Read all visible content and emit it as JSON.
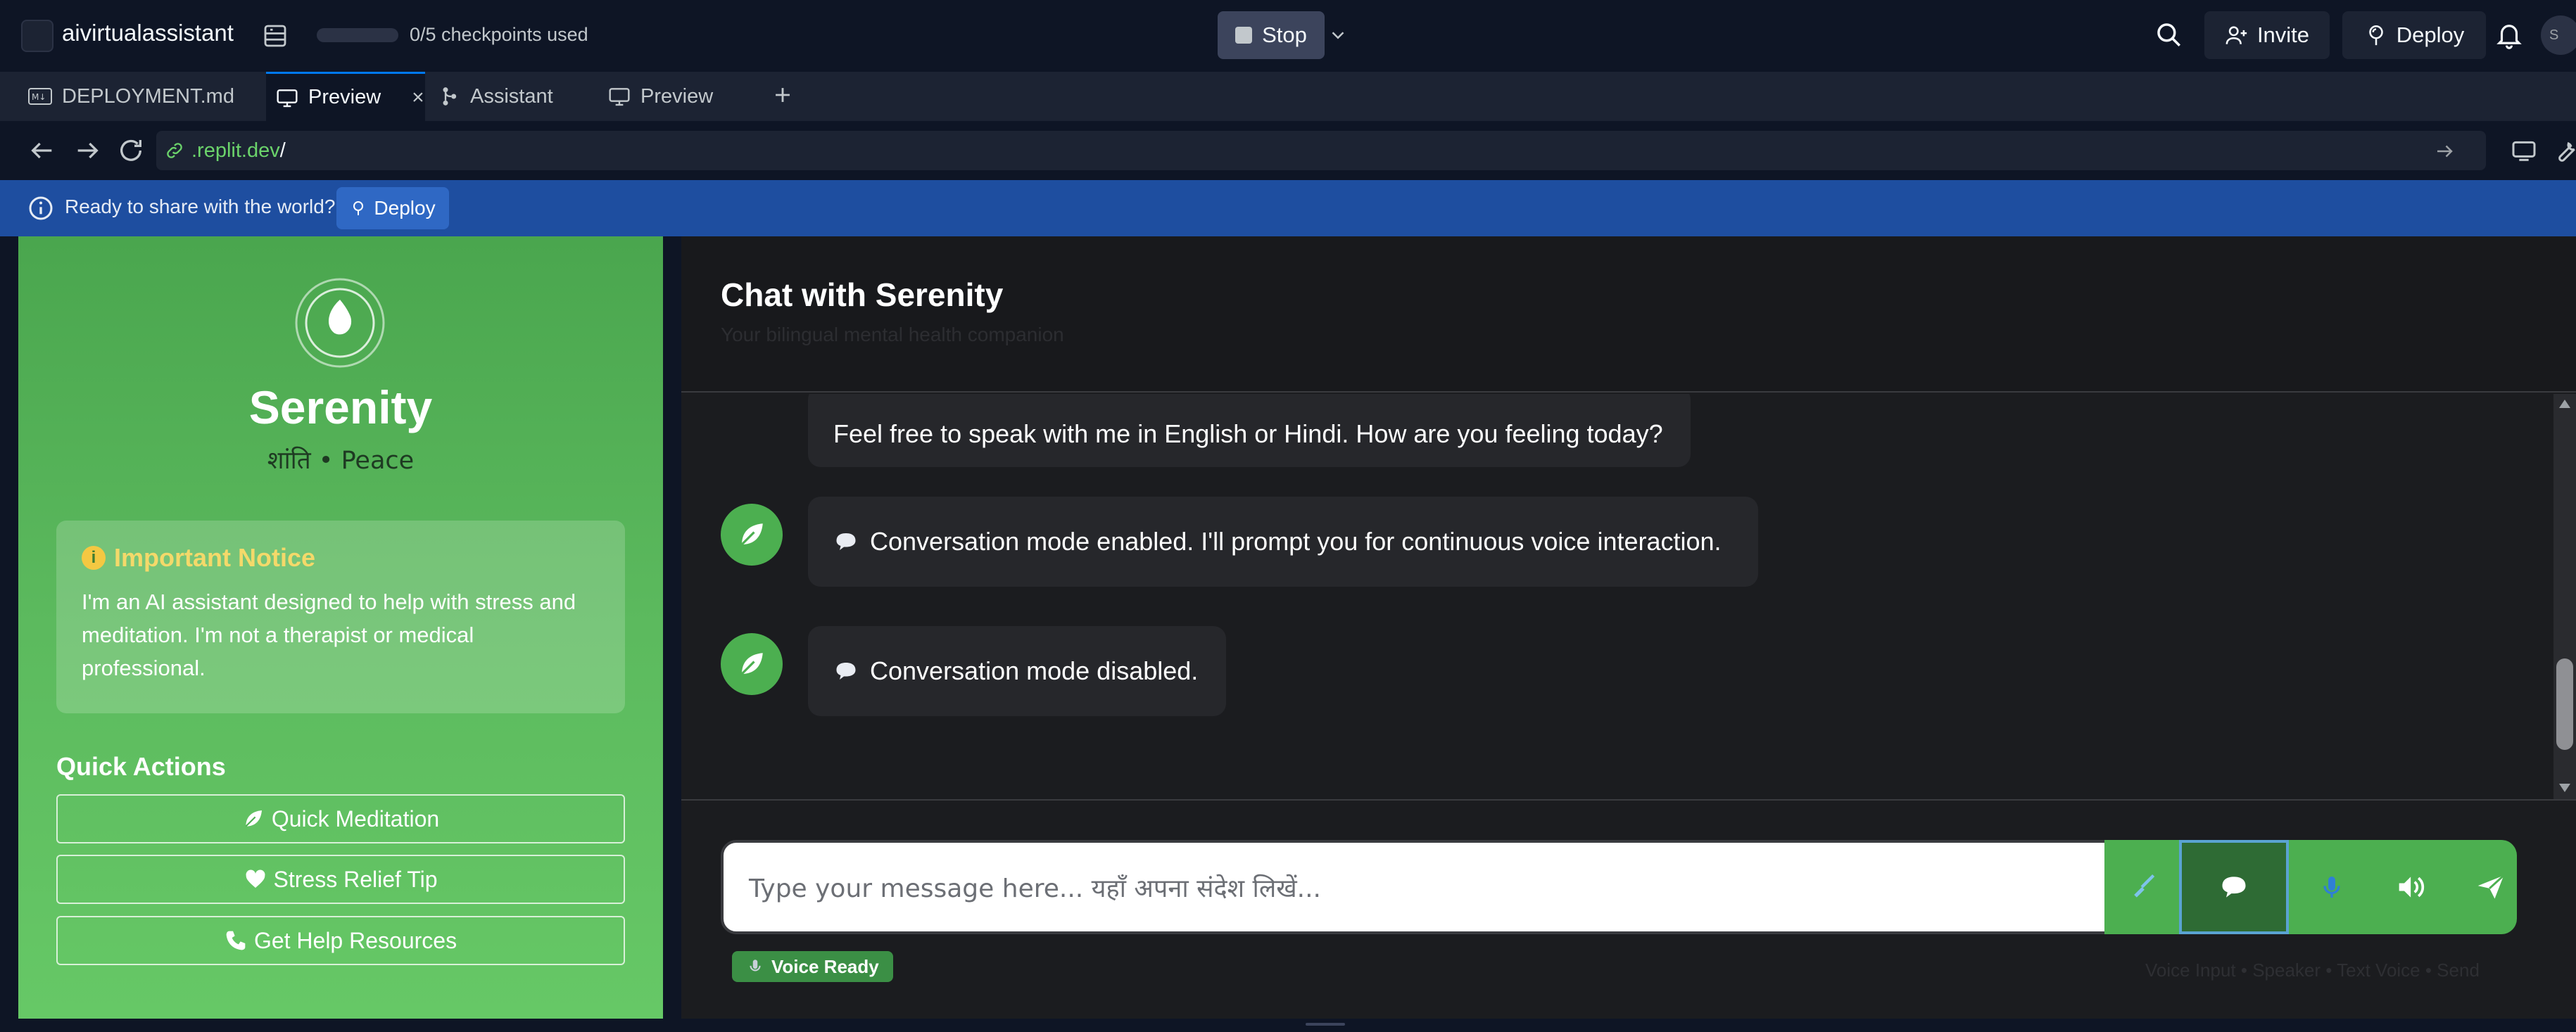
{
  "topbar": {
    "app_name": "aivirtualassistant",
    "checkpoints": "0/5 checkpoints used",
    "stop_label": "Stop",
    "invite_label": "Invite",
    "deploy_label": "Deploy",
    "avatar_initial": "S"
  },
  "tabs": [
    {
      "label": "DEPLOYMENT.md",
      "icon": "markdown-icon"
    },
    {
      "label": "Preview",
      "icon": "monitor-icon",
      "active": true
    },
    {
      "label": "Assistant",
      "icon": "assistant-icon"
    },
    {
      "label": "Preview",
      "icon": "monitor-icon"
    }
  ],
  "url": {
    "domain": ".replit.dev",
    "path": "/"
  },
  "banner": {
    "text": "Ready to share with the world?",
    "button": "Deploy"
  },
  "sidebar": {
    "title": "Serenity",
    "subtitle": "शांति • Peace",
    "notice_title": "Important Notice",
    "notice_body": "I'm an AI assistant designed to help with stress and meditation. I'm not a therapist or medical professional.",
    "quick_actions_title": "Quick Actions",
    "quick_actions": [
      {
        "label": "Quick Meditation",
        "icon": "leaf-icon"
      },
      {
        "label": "Stress Relief Tip",
        "icon": "heart-icon"
      },
      {
        "label": "Get Help Resources",
        "icon": "phone-icon"
      }
    ]
  },
  "chat": {
    "title": "Chat with Serenity",
    "subtitle": "Your bilingual mental health companion",
    "messages": [
      {
        "text": "Feel free to speak with me in English or Hindi. How are you feeling today?"
      },
      {
        "text": "Conversation mode enabled. I'll prompt you for continuous voice interaction."
      },
      {
        "text": "Conversation mode disabled."
      }
    ],
    "input_placeholder": "Type your message here... यहाँ अपना संदेश लिखें...",
    "voice_status": "Voice Ready",
    "hint": "Voice Input • Speaker • Text Voice • Send"
  },
  "colors": {
    "sidebar_green": "#4caf50",
    "banner_blue": "#1e4ea0",
    "accent_blue": "#0079f2"
  }
}
